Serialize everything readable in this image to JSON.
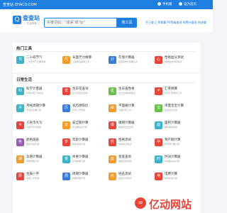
{
  "topbar": {
    "site_name": "查查站 ZHACO.COM",
    "links": [
      "手机版",
      "设为首页",
      "收藏本站"
    ]
  },
  "header": {
    "logo_icon": "search-icon",
    "logo_char": "Q",
    "logo_title": "查查站",
    "logo_subtitle": "— 生活查询 —",
    "search_placeholder": "关键词如：\"成语\"或\"ip\"",
    "search_button": "我工具",
    "hot_keywords": "生日查 汇率换算 PS等级查询 电费计量表 快递查"
  },
  "hot": {
    "title": "热门工具",
    "items": [
      {
        "name": "二十四节气",
        "desc": "二十四节气日期查询",
        "icon": "calendar-icon",
        "color": "#3db3c9",
        "glyph": "节"
      },
      {
        "name": "长度尺寸换算",
        "desc": "长度单位换算工具",
        "icon": "ruler-icon",
        "color": "#f29b28",
        "glyph": "尺"
      },
      {
        "name": "在线计算器",
        "desc": "在线科学计算器工具",
        "icon": "calculator-icon",
        "color": "#3a7bd5",
        "glyph": "计"
      },
      {
        "name": "性格血分测试",
        "desc": "性格血型分析测试",
        "icon": "heart-icon",
        "color": "#e8443a",
        "glyph": "心"
      }
    ]
  },
  "daily": {
    "title": "日常生活",
    "items": [
      {
        "name": "科学计量器",
        "desc": "科学计算工具在线",
        "icon": "calculator-icon",
        "color": "#3db3c9",
        "glyph": "科"
      },
      {
        "name": "生日花查询",
        "desc": "生日对应花查询",
        "icon": "flower-icon",
        "color": "#e8443a",
        "glyph": "花"
      },
      {
        "name": "生日查性格",
        "desc": "生日查询性格特点",
        "icon": "star-icon",
        "color": "#6abf4b",
        "glyph": "星"
      },
      {
        "name": "汇率换算",
        "desc": "货币汇率换算工具",
        "icon": "money-icon",
        "color": "#e8443a",
        "glyph": "¥"
      },
      {
        "name": "月经周期计算",
        "desc": "月经安全期计算",
        "icon": "calendar-icon",
        "color": "#3db3c9",
        "glyph": "月"
      },
      {
        "name": "农历阴阳历",
        "desc": "农历公历转换",
        "icon": "calendar-icon",
        "color": "#3a7bd5",
        "glyph": "历"
      },
      {
        "name": "平面磁计算",
        "desc": "平面计算工具",
        "icon": "grid-icon",
        "color": "#f29b28",
        "glyph": "磁"
      },
      {
        "name": "单量宝宝计算",
        "desc": "宝宝成长计算",
        "icon": "baby-icon",
        "color": "#6abf4b",
        "glyph": "宝"
      },
      {
        "name": "人民币大写",
        "desc": "人民币大写转换",
        "icon": "money-icon",
        "color": "#e8443a",
        "glyph": "¥"
      },
      {
        "name": "安全期计算",
        "desc": "安全期在线计算",
        "icon": "shield-icon",
        "color": "#f29b28",
        "glyph": "安"
      },
      {
        "name": "婚期计算器",
        "desc": "结婚纪念日计算",
        "icon": "ring-icon",
        "color": "#e8443a",
        "glyph": "婚"
      },
      {
        "name": "面积计算器",
        "desc": "面积单位换算",
        "icon": "area-icon",
        "color": "#3db3c9",
        "glyph": "面"
      },
      {
        "name": "颜色值表",
        "desc": "颜色代码查询",
        "icon": "palette-icon",
        "color": "#9b59b6",
        "glyph": "色"
      },
      {
        "name": "年龄计算器",
        "desc": "年龄在线计算",
        "icon": "person-icon",
        "color": "#e8443a",
        "glyph": "岁"
      },
      {
        "name": "性格测试",
        "desc": "性格特点测试",
        "icon": "heart-icon",
        "color": "#e8443a",
        "glyph": "性"
      },
      {
        "name": "预产期计算",
        "desc": "怀孕预产期计算",
        "icon": "baby-icon",
        "color": "#e8443a",
        "glyph": "孕"
      },
      {
        "name": "孕期计算器",
        "desc": "孕期周数计算",
        "icon": "baby-icon",
        "color": "#f29b28",
        "glyph": "期"
      },
      {
        "name": "体重计算器",
        "desc": "标准体重计算",
        "icon": "scale-icon",
        "color": "#3db3c9",
        "glyph": "重"
      },
      {
        "name": "星座查询",
        "desc": "星座运势查询",
        "icon": "star-icon",
        "color": "#f29b28",
        "glyph": "座"
      },
      {
        "name": "时间计算器",
        "desc": "时间差在线计算",
        "icon": "clock-icon",
        "color": "#3db3c9",
        "glyph": "时"
      },
      {
        "name": "生辰八字",
        "desc": "生辰八字查询",
        "icon": "book-icon",
        "color": "#e8443a",
        "glyph": "辰"
      },
      {
        "name": "周期计算器",
        "desc": "周期天数计算",
        "icon": "clock-icon",
        "color": "#3a7bd5",
        "glyph": "周"
      },
      {
        "name": "姓名测试",
        "desc": "姓名打分测试",
        "icon": "person-icon",
        "color": "#f29b28",
        "glyph": "名"
      },
      {
        "name": "电费计算",
        "desc": "电费在线计算",
        "icon": "bolt-icon",
        "color": "#e8443a",
        "glyph": "电"
      }
    ]
  },
  "watermark": {
    "icon": "brand-logo-icon",
    "text": "亿动网站"
  }
}
